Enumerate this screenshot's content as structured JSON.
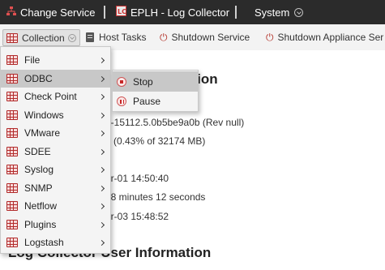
{
  "topbar": {
    "change_service": "Change Service",
    "service_name": "EPLH - Log Collector",
    "system": "System"
  },
  "toolbar": {
    "collection": "Collection",
    "host_tasks": "Host Tasks",
    "shutdown_service": "Shutdown Service",
    "shutdown_appliance": "Shutdown Appliance Ser"
  },
  "menu": {
    "items": [
      {
        "label": "File"
      },
      {
        "label": "ODBC"
      },
      {
        "label": "Check Point"
      },
      {
        "label": "Windows"
      },
      {
        "label": "VMware"
      },
      {
        "label": "SDEE"
      },
      {
        "label": "Syslog"
      },
      {
        "label": "SNMP"
      },
      {
        "label": "Netflow"
      },
      {
        "label": "Plugins"
      },
      {
        "label": "Logstash"
      }
    ],
    "active_index": 1
  },
  "submenu": {
    "items": [
      {
        "label": "Stop",
        "icon": "stop-icon"
      },
      {
        "label": "Pause",
        "icon": "pause-icon"
      }
    ]
  },
  "main": {
    "section1_title": "ation",
    "info": [
      "0-15112.5.0b5be9a0b (Rev null)",
      "3 (0.43% of 32174 MB)",
      "pr-01 14:50:40",
      "58 minutes 12 seconds",
      "pr-03 15:48:52"
    ],
    "section2_title": "Log Collector User Information"
  },
  "colors": {
    "topbar_bg": "#2b2b2b",
    "toolbar_bg": "#f3f3f3",
    "accent_red": "#b22b2b",
    "menu_active": "#c8c8c8"
  }
}
